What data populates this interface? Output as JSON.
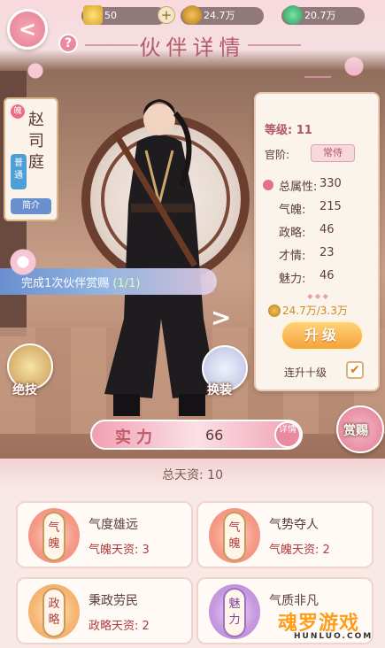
{
  "header": {
    "title": "伙伴详情",
    "back_symbol": "<",
    "help_symbol": "?",
    "resources": [
      {
        "icon": "gold-ingot-icon",
        "value": "50"
      },
      {
        "icon": "coin-icon",
        "value": "24.7万"
      },
      {
        "icon": "jade-icon",
        "value": "20.7万"
      }
    ],
    "add_symbol": "+"
  },
  "partner": {
    "tag": "魄",
    "name": "赵司庭",
    "rarity": "普通",
    "group": "简介"
  },
  "stats": {
    "level": "等级: 11",
    "rank_label": "官阶:",
    "rank_value": "常侍",
    "total_label": "总属性:",
    "total_value": "330",
    "attributes": [
      {
        "label": "气魄:",
        "value": "215"
      },
      {
        "label": "政略:",
        "value": "46"
      },
      {
        "label": "才情:",
        "value": "23"
      },
      {
        "label": "魅力:",
        "value": "46"
      }
    ],
    "cost": "24.7万/3.3万",
    "upgrade_label": "升级",
    "ten_levels_label": "连升十级",
    "ten_levels_checked": "✔"
  },
  "task": {
    "text": "完成1次伙伴赏赐",
    "progress": "(1/1)"
  },
  "actions": {
    "skill_label": "绝技",
    "costume_label": "换装",
    "reward_label": "赏赐",
    "next_symbol": ">"
  },
  "power": {
    "label": "实力",
    "value": "66",
    "detail_label": "详情"
  },
  "talents": {
    "total": "总天资: 10",
    "cards": [
      {
        "tag": "气魄",
        "name": "气度雄远",
        "value": "气魄天资: 3"
      },
      {
        "tag": "气魄",
        "name": "气势夺人",
        "value": "气魄天资: 2"
      },
      {
        "tag": "政略",
        "name": "秉政劳民",
        "value": "政略天资: 2"
      },
      {
        "tag": "魅力",
        "name": "气质非凡",
        "value": ""
      }
    ]
  },
  "watermark": {
    "text": "魂罗游戏",
    "sub": "HUNLUO.COM"
  },
  "colors": {
    "accent_pink": "#e57f96",
    "title": "#b35a6c",
    "gold": "#f5a23a",
    "task_blue": "#6a8fcf"
  }
}
